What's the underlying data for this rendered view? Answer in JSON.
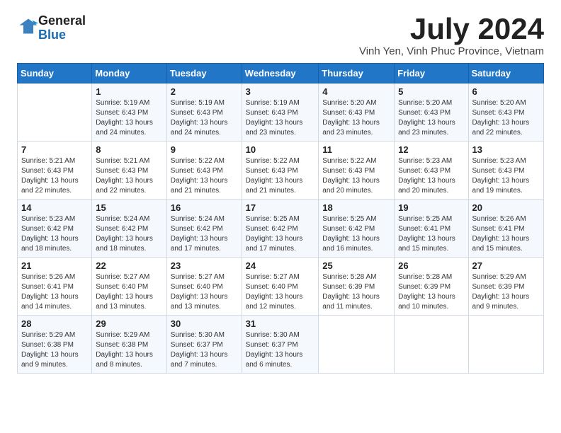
{
  "logo": {
    "line1": "General",
    "line2": "Blue"
  },
  "title": "July 2024",
  "location": "Vinh Yen, Vinh Phuc Province, Vietnam",
  "days_of_week": [
    "Sunday",
    "Monday",
    "Tuesday",
    "Wednesday",
    "Thursday",
    "Friday",
    "Saturday"
  ],
  "weeks": [
    [
      {
        "day": "",
        "sunrise": "",
        "sunset": "",
        "daylight": ""
      },
      {
        "day": "1",
        "sunrise": "5:19 AM",
        "sunset": "6:43 PM",
        "daylight": "13 hours and 24 minutes."
      },
      {
        "day": "2",
        "sunrise": "5:19 AM",
        "sunset": "6:43 PM",
        "daylight": "13 hours and 24 minutes."
      },
      {
        "day": "3",
        "sunrise": "5:19 AM",
        "sunset": "6:43 PM",
        "daylight": "13 hours and 23 minutes."
      },
      {
        "day": "4",
        "sunrise": "5:20 AM",
        "sunset": "6:43 PM",
        "daylight": "13 hours and 23 minutes."
      },
      {
        "day": "5",
        "sunrise": "5:20 AM",
        "sunset": "6:43 PM",
        "daylight": "13 hours and 23 minutes."
      },
      {
        "day": "6",
        "sunrise": "5:20 AM",
        "sunset": "6:43 PM",
        "daylight": "13 hours and 22 minutes."
      }
    ],
    [
      {
        "day": "7",
        "sunrise": "5:21 AM",
        "sunset": "6:43 PM",
        "daylight": "13 hours and 22 minutes."
      },
      {
        "day": "8",
        "sunrise": "5:21 AM",
        "sunset": "6:43 PM",
        "daylight": "13 hours and 22 minutes."
      },
      {
        "day": "9",
        "sunrise": "5:22 AM",
        "sunset": "6:43 PM",
        "daylight": "13 hours and 21 minutes."
      },
      {
        "day": "10",
        "sunrise": "5:22 AM",
        "sunset": "6:43 PM",
        "daylight": "13 hours and 21 minutes."
      },
      {
        "day": "11",
        "sunrise": "5:22 AM",
        "sunset": "6:43 PM",
        "daylight": "13 hours and 20 minutes."
      },
      {
        "day": "12",
        "sunrise": "5:23 AM",
        "sunset": "6:43 PM",
        "daylight": "13 hours and 20 minutes."
      },
      {
        "day": "13",
        "sunrise": "5:23 AM",
        "sunset": "6:43 PM",
        "daylight": "13 hours and 19 minutes."
      }
    ],
    [
      {
        "day": "14",
        "sunrise": "5:23 AM",
        "sunset": "6:42 PM",
        "daylight": "13 hours and 18 minutes."
      },
      {
        "day": "15",
        "sunrise": "5:24 AM",
        "sunset": "6:42 PM",
        "daylight": "13 hours and 18 minutes."
      },
      {
        "day": "16",
        "sunrise": "5:24 AM",
        "sunset": "6:42 PM",
        "daylight": "13 hours and 17 minutes."
      },
      {
        "day": "17",
        "sunrise": "5:25 AM",
        "sunset": "6:42 PM",
        "daylight": "13 hours and 17 minutes."
      },
      {
        "day": "18",
        "sunrise": "5:25 AM",
        "sunset": "6:42 PM",
        "daylight": "13 hours and 16 minutes."
      },
      {
        "day": "19",
        "sunrise": "5:25 AM",
        "sunset": "6:41 PM",
        "daylight": "13 hours and 15 minutes."
      },
      {
        "day": "20",
        "sunrise": "5:26 AM",
        "sunset": "6:41 PM",
        "daylight": "13 hours and 15 minutes."
      }
    ],
    [
      {
        "day": "21",
        "sunrise": "5:26 AM",
        "sunset": "6:41 PM",
        "daylight": "13 hours and 14 minutes."
      },
      {
        "day": "22",
        "sunrise": "5:27 AM",
        "sunset": "6:40 PM",
        "daylight": "13 hours and 13 minutes."
      },
      {
        "day": "23",
        "sunrise": "5:27 AM",
        "sunset": "6:40 PM",
        "daylight": "13 hours and 13 minutes."
      },
      {
        "day": "24",
        "sunrise": "5:27 AM",
        "sunset": "6:40 PM",
        "daylight": "13 hours and 12 minutes."
      },
      {
        "day": "25",
        "sunrise": "5:28 AM",
        "sunset": "6:39 PM",
        "daylight": "13 hours and 11 minutes."
      },
      {
        "day": "26",
        "sunrise": "5:28 AM",
        "sunset": "6:39 PM",
        "daylight": "13 hours and 10 minutes."
      },
      {
        "day": "27",
        "sunrise": "5:29 AM",
        "sunset": "6:39 PM",
        "daylight": "13 hours and 9 minutes."
      }
    ],
    [
      {
        "day": "28",
        "sunrise": "5:29 AM",
        "sunset": "6:38 PM",
        "daylight": "13 hours and 9 minutes."
      },
      {
        "day": "29",
        "sunrise": "5:29 AM",
        "sunset": "6:38 PM",
        "daylight": "13 hours and 8 minutes."
      },
      {
        "day": "30",
        "sunrise": "5:30 AM",
        "sunset": "6:37 PM",
        "daylight": "13 hours and 7 minutes."
      },
      {
        "day": "31",
        "sunrise": "5:30 AM",
        "sunset": "6:37 PM",
        "daylight": "13 hours and 6 minutes."
      },
      {
        "day": "",
        "sunrise": "",
        "sunset": "",
        "daylight": ""
      },
      {
        "day": "",
        "sunrise": "",
        "sunset": "",
        "daylight": ""
      },
      {
        "day": "",
        "sunrise": "",
        "sunset": "",
        "daylight": ""
      }
    ]
  ]
}
